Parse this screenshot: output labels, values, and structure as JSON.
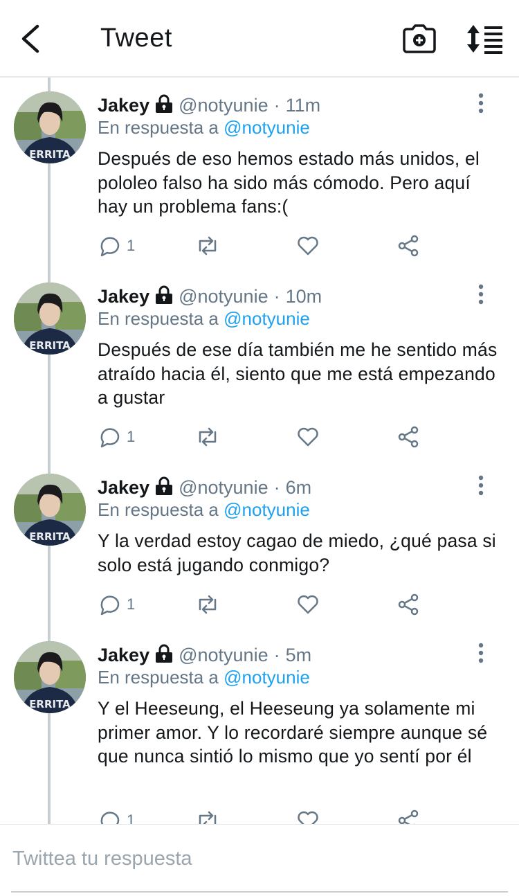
{
  "header": {
    "title": "Tweet",
    "icons": {
      "back": "chevron-left-icon",
      "camera": "camera-add-icon",
      "sort": "sort-list-icon"
    }
  },
  "tweets": [
    {
      "name": "Jakey",
      "handle": "@notyunie",
      "dot": "·",
      "time": "11m",
      "reply_prefix": "En respuesta a",
      "reply_to": "@notyunie",
      "text": "Después de eso hemos estado más unidos, el pololeo falso ha sido más cómodo. Pero aquí hay un problema fans:(",
      "reply_count": "1"
    },
    {
      "name": "Jakey",
      "handle": "@notyunie",
      "dot": "·",
      "time": "10m",
      "reply_prefix": "En respuesta a",
      "reply_to": "@notyunie",
      "text": "Después de ese día también me he sentido más atraído hacia él, siento que me está empezando a gustar",
      "reply_count": "1"
    },
    {
      "name": "Jakey",
      "handle": "@notyunie",
      "dot": "·",
      "time": "6m",
      "reply_prefix": "En respuesta a",
      "reply_to": "@notyunie",
      "text": "Y la verdad estoy cagao de miedo, ¿qué pasa si solo está jugando conmigo?",
      "reply_count": "1"
    },
    {
      "name": "Jakey",
      "handle": "@notyunie",
      "dot": "·",
      "time": "5m",
      "reply_prefix": "En respuesta a",
      "reply_to": "@notyunie",
      "text": "Y el Heeseung, el Heeseung ya solamente mi primer amor. Y lo recordaré siempre aunque sé que nunca sintió lo mismo que yo sentí por él",
      "reply_count": "1"
    }
  ],
  "compose": {
    "placeholder": "Twittea tu respuesta"
  },
  "colors": {
    "accent": "#1da1f2",
    "secondary_text": "#657786",
    "primary_text": "#14171a",
    "divider": "#e6e9eb"
  }
}
